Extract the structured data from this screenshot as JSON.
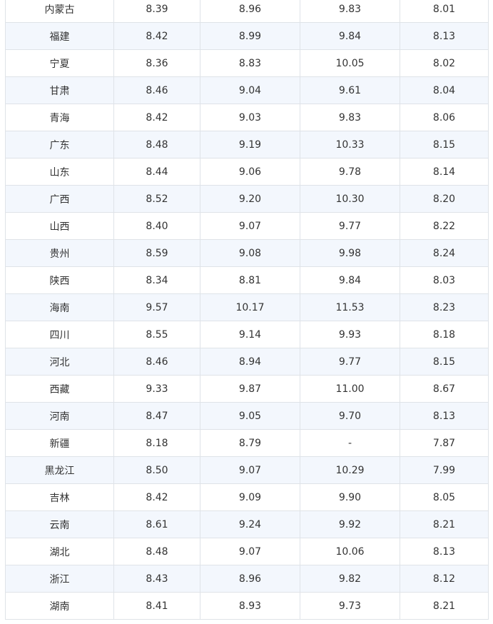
{
  "table": {
    "rows": [
      {
        "region": "内蒙古",
        "v1": "8.39",
        "v2": "8.96",
        "v3": "9.83",
        "v4": "8.01"
      },
      {
        "region": "福建",
        "v1": "8.42",
        "v2": "8.99",
        "v3": "9.84",
        "v4": "8.13"
      },
      {
        "region": "宁夏",
        "v1": "8.36",
        "v2": "8.83",
        "v3": "10.05",
        "v4": "8.02"
      },
      {
        "region": "甘肃",
        "v1": "8.46",
        "v2": "9.04",
        "v3": "9.61",
        "v4": "8.04"
      },
      {
        "region": "青海",
        "v1": "8.42",
        "v2": "9.03",
        "v3": "9.83",
        "v4": "8.06"
      },
      {
        "region": "广东",
        "v1": "8.48",
        "v2": "9.19",
        "v3": "10.33",
        "v4": "8.15"
      },
      {
        "region": "山东",
        "v1": "8.44",
        "v2": "9.06",
        "v3": "9.78",
        "v4": "8.14"
      },
      {
        "region": "广西",
        "v1": "8.52",
        "v2": "9.20",
        "v3": "10.30",
        "v4": "8.20"
      },
      {
        "region": "山西",
        "v1": "8.40",
        "v2": "9.07",
        "v3": "9.77",
        "v4": "8.22"
      },
      {
        "region": "贵州",
        "v1": "8.59",
        "v2": "9.08",
        "v3": "9.98",
        "v4": "8.24"
      },
      {
        "region": "陕西",
        "v1": "8.34",
        "v2": "8.81",
        "v3": "9.84",
        "v4": "8.03"
      },
      {
        "region": "海南",
        "v1": "9.57",
        "v2": "10.17",
        "v3": "11.53",
        "v4": "8.23"
      },
      {
        "region": "四川",
        "v1": "8.55",
        "v2": "9.14",
        "v3": "9.93",
        "v4": "8.18"
      },
      {
        "region": "河北",
        "v1": "8.46",
        "v2": "8.94",
        "v3": "9.77",
        "v4": "8.15"
      },
      {
        "region": "西藏",
        "v1": "9.33",
        "v2": "9.87",
        "v3": "11.00",
        "v4": "8.67"
      },
      {
        "region": "河南",
        "v1": "8.47",
        "v2": "9.05",
        "v3": "9.70",
        "v4": "8.13"
      },
      {
        "region": "新疆",
        "v1": "8.18",
        "v2": "8.79",
        "v3": "-",
        "v4": "7.87"
      },
      {
        "region": "黑龙江",
        "v1": "8.50",
        "v2": "9.07",
        "v3": "10.29",
        "v4": "7.99"
      },
      {
        "region": "吉林",
        "v1": "8.42",
        "v2": "9.09",
        "v3": "9.90",
        "v4": "8.05"
      },
      {
        "region": "云南",
        "v1": "8.61",
        "v2": "9.24",
        "v3": "9.92",
        "v4": "8.21"
      },
      {
        "region": "湖北",
        "v1": "8.48",
        "v2": "9.07",
        "v3": "10.06",
        "v4": "8.13"
      },
      {
        "region": "浙江",
        "v1": "8.43",
        "v2": "8.96",
        "v3": "9.82",
        "v4": "8.12"
      },
      {
        "region": "湖南",
        "v1": "8.41",
        "v2": "8.93",
        "v3": "9.73",
        "v4": "8.21"
      }
    ]
  }
}
